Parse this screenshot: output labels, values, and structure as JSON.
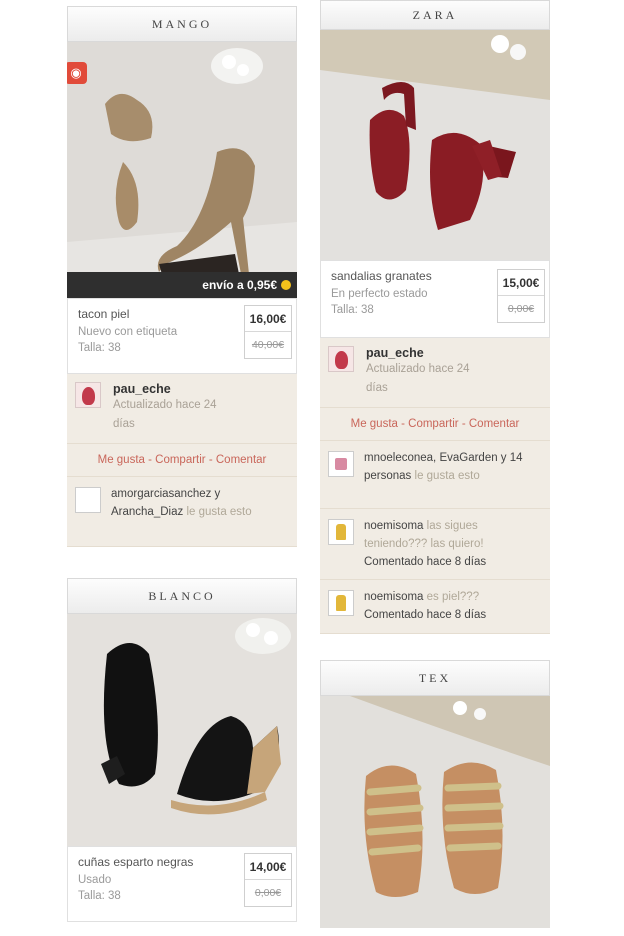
{
  "cards": {
    "mango": {
      "brand": "MANGO",
      "shipping": "envío a 0,95€",
      "title": "tacon piel",
      "condition": "Nuevo con etiqueta",
      "size": "Talla: 38",
      "price": "16,00€",
      "old_price": "40,00€",
      "user": {
        "name": "pau_eche",
        "updated": "Actualizado hace 24 días"
      },
      "actions": [
        "Me gusta",
        "Compartir",
        "Comentar"
      ],
      "likes": {
        "names": "amorgarciasanchez y Arancha_Diaz",
        "suffix": "le gusta esto"
      }
    },
    "zara": {
      "brand": "ZARA",
      "title": "sandalias granates",
      "condition": "En perfecto estado",
      "size": "Talla: 38",
      "price": "15,00€",
      "old_price": "0,00€",
      "user": {
        "name": "pau_eche",
        "updated": "Actualizado hace 24 días"
      },
      "actions": [
        "Me gusta",
        "Compartir",
        "Comentar"
      ],
      "likes": {
        "names": "mnoeleconea, EvaGarden y 14 personas",
        "suffix": "le gusta esto"
      },
      "comments": [
        {
          "user": "noemisoma",
          "text": "las sigues teniendo??? las quiero!",
          "time": "Comentado hace 8 días"
        },
        {
          "user": "noemisoma",
          "text": "es piel???",
          "time": "Comentado hace 8 días"
        }
      ]
    },
    "blanco": {
      "brand": "BLANCO",
      "title": "cuñas esparto negras",
      "condition": "Usado",
      "size": "Talla: 38",
      "price": "14,00€",
      "old_price": "0,00€"
    },
    "tex": {
      "brand": "TEX"
    }
  },
  "separator": " - ",
  "colors": {
    "accent": "#c9665a",
    "ship_bar": "#2f2f2f",
    "beige": "#f1ece4",
    "sale_tag": "#e14b3a"
  },
  "icons": {
    "sale": "tag-icon",
    "coin": "coin-icon"
  }
}
